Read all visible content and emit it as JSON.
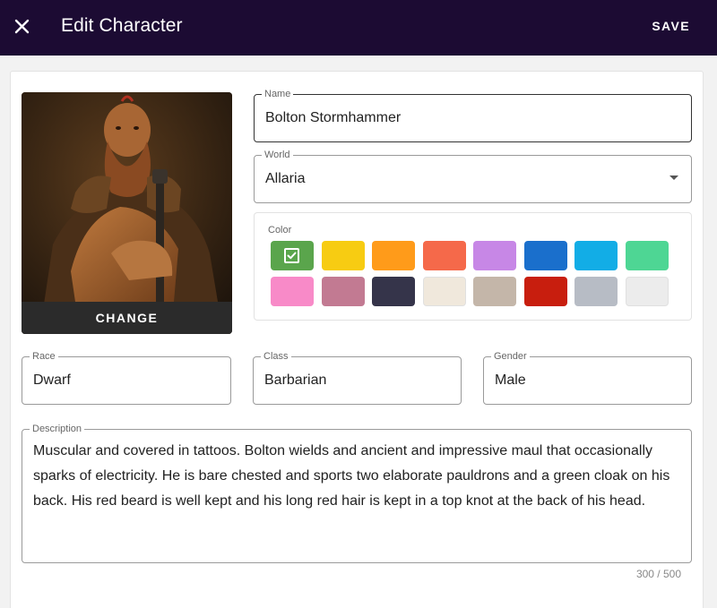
{
  "appbar": {
    "title": "Edit Character",
    "close_icon": "close-icon",
    "save_label": "SAVE",
    "background": "#1c0b33"
  },
  "portrait": {
    "change_label": "CHANGE"
  },
  "fields": {
    "name": {
      "label": "Name",
      "value": "Bolton Stormhammer"
    },
    "world": {
      "label": "World",
      "value": "Allaria"
    },
    "race": {
      "label": "Race",
      "value": "Dwarf"
    },
    "class": {
      "label": "Class",
      "value": "Barbarian"
    },
    "gender": {
      "label": "Gender",
      "value": "Male"
    },
    "description": {
      "label": "Description",
      "value": "Muscular and covered in tattoos. Bolton wields and ancient and impressive maul that occasionally sparks of electricity. He is bare chested and sports two elaborate pauldrons and a green cloak on his back. His red beard is well kept and his long red hair is kept in a top knot at the back of his head.",
      "counter": "300 / 500"
    }
  },
  "color_picker": {
    "label": "Color",
    "selected_index": 0,
    "swatches": [
      "#5aa54c",
      "#f7cc12",
      "#ff9b1a",
      "#f5694a",
      "#c787e6",
      "#1a6fcc",
      "#12ade6",
      "#4ed694",
      "#f88ac8",
      "#c27a92",
      "#35344a",
      "#f0e8dc",
      "#c4b6a9",
      "#c81e0e",
      "#b7bcc5",
      "#ececec"
    ]
  }
}
